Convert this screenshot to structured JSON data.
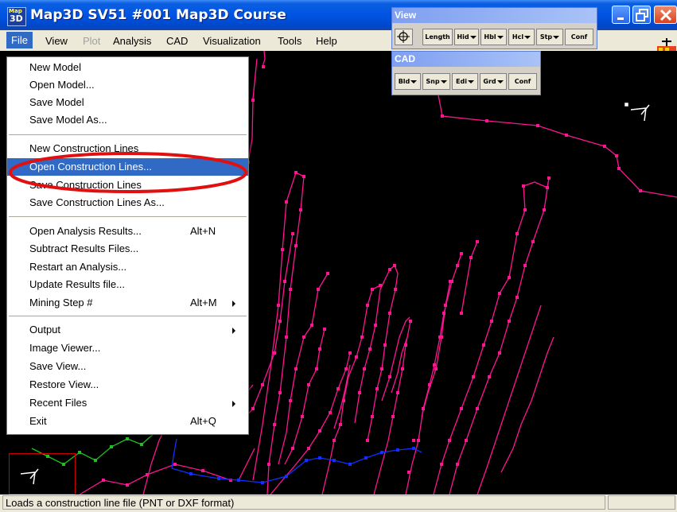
{
  "app": {
    "icon_lines": [
      "Map",
      "3D"
    ],
    "title": "Map3D SV51 #001  Map3D Course"
  },
  "menubar": {
    "items": [
      {
        "label": "File",
        "disabled": false
      },
      {
        "label": "View",
        "disabled": false
      },
      {
        "label": "Plot",
        "disabled": true
      },
      {
        "label": "Analysis",
        "disabled": false
      },
      {
        "label": "CAD",
        "disabled": false
      },
      {
        "label": "Visualization",
        "disabled": false
      },
      {
        "label": "Tools",
        "disabled": false
      },
      {
        "label": "Help",
        "disabled": false
      }
    ]
  },
  "file_menu": {
    "items": [
      {
        "label": "New Model",
        "shortcut": "",
        "submenu": false
      },
      {
        "label": "Open Model...",
        "shortcut": "",
        "submenu": false
      },
      {
        "label": "Save Model",
        "shortcut": "",
        "submenu": false
      },
      {
        "label": "Save Model As...",
        "shortcut": "",
        "submenu": false
      },
      {
        "label": "New Construction Lines",
        "shortcut": "",
        "submenu": false
      },
      {
        "label": "Open Construction Lines...",
        "shortcut": "",
        "submenu": false,
        "highlighted": true
      },
      {
        "label": "Save Construction Lines",
        "shortcut": "",
        "submenu": false
      },
      {
        "label": "Save Construction Lines As...",
        "shortcut": "",
        "submenu": false
      },
      {
        "label": "Open Analysis Results...",
        "shortcut": "Alt+N",
        "submenu": false
      },
      {
        "label": "Subtract Results Files...",
        "shortcut": "",
        "submenu": false
      },
      {
        "label": "Restart an Analysis...",
        "shortcut": "",
        "submenu": false
      },
      {
        "label": "Update Results file...",
        "shortcut": "",
        "submenu": false
      },
      {
        "label": "Mining Step #",
        "shortcut": "Alt+M",
        "submenu": true
      },
      {
        "label": "Output",
        "shortcut": "",
        "submenu": true
      },
      {
        "label": "Image Viewer...",
        "shortcut": "",
        "submenu": false
      },
      {
        "label": "Save View...",
        "shortcut": "",
        "submenu": false
      },
      {
        "label": "Restore View...",
        "shortcut": "",
        "submenu": false
      },
      {
        "label": "Recent Files",
        "shortcut": "",
        "submenu": true
      },
      {
        "label": "Exit",
        "shortcut": "Alt+Q",
        "submenu": false
      }
    ]
  },
  "view_toolbar": {
    "title": "View",
    "buttons": [
      {
        "label": "",
        "icon": "crosshair-icon",
        "dropdown": false
      },
      {
        "label": "Length",
        "dropdown": false
      },
      {
        "label": "Hid",
        "dropdown": true
      },
      {
        "label": "Hbl",
        "dropdown": true
      },
      {
        "label": "Hcl",
        "dropdown": true
      },
      {
        "label": "Stp",
        "dropdown": true
      },
      {
        "label": "Conf",
        "dropdown": false
      }
    ]
  },
  "cad_toolbar": {
    "title": "CAD",
    "buttons": [
      {
        "label": "Bld",
        "dropdown": true
      },
      {
        "label": "Snp",
        "dropdown": true
      },
      {
        "label": "Edi",
        "dropdown": true
      },
      {
        "label": "Grd",
        "dropdown": true
      },
      {
        "label": "Conf",
        "dropdown": false
      }
    ]
  },
  "status": {
    "text": "Loads a construction line file (PNT or DXF format)"
  },
  "colors": {
    "titlebar": "#0054e3",
    "menu_highlight": "#316ac5",
    "canvas": "#000000",
    "lines_magenta": "#ff1493",
    "lines_blue": "#1030ff",
    "lines_green": "#20c020",
    "annotation_red": "#e01010"
  }
}
